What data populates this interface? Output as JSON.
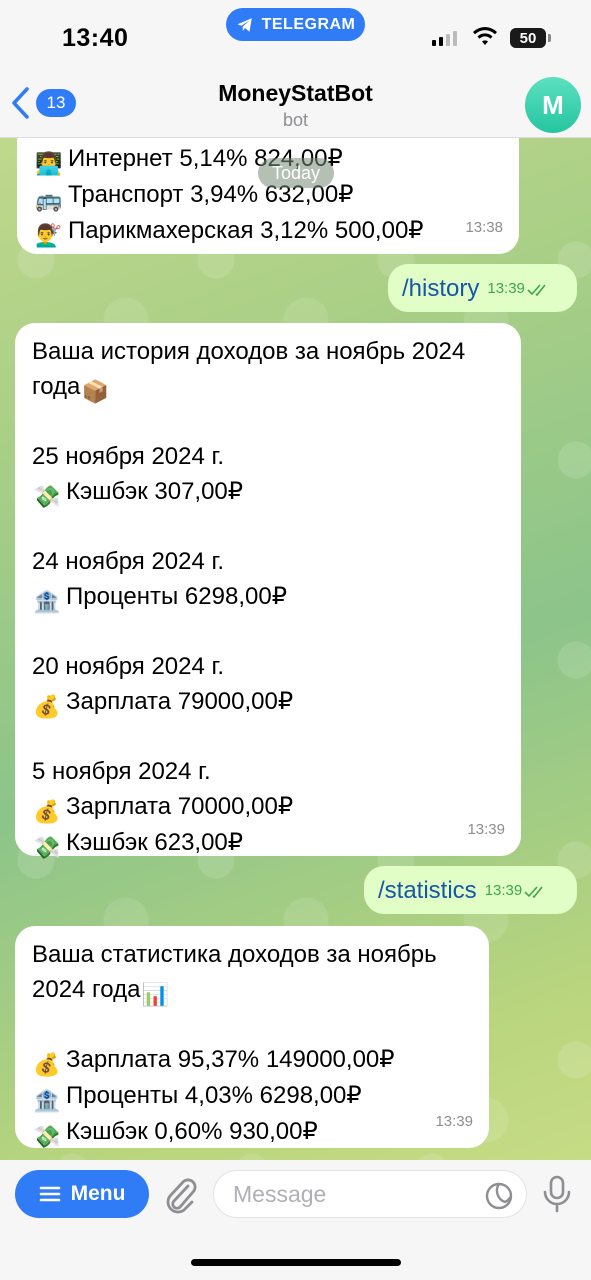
{
  "status_bar": {
    "time": "13:40",
    "app_pill": "TELEGRAM",
    "battery": "50"
  },
  "header": {
    "back_count": "13",
    "title": "MoneyStatBot",
    "subtitle": "bot",
    "avatar_letter": "M"
  },
  "date_chip": "Today",
  "messages": {
    "top_partial": {
      "lines": [
        {
          "emoji": "computer-person-emoji",
          "text": "Интернет 5,14% 824,00₽"
        },
        {
          "emoji": "bus-emoji",
          "text": "Транспорт 3,94% 632,00₽"
        },
        {
          "emoji": "haircut-person-emoji",
          "text": "Парикмахерская 3,12% 500,00₽"
        }
      ],
      "time": "13:38"
    },
    "cmd_history": {
      "text": "/history",
      "time": "13:39"
    },
    "history": {
      "title_line1": "Ваша история доходов за ноябрь 2024",
      "title_line2": "года",
      "entries": [
        {
          "date": "25 ноября 2024 г.",
          "items": [
            {
              "emoji": "money-wings-emoji",
              "text": "Кэшбэк 307,00₽"
            }
          ]
        },
        {
          "date": "24 ноября 2024 г.",
          "items": [
            {
              "emoji": "bank-emoji",
              "text": "Проценты 6298,00₽"
            }
          ]
        },
        {
          "date": "20 ноября 2024 г.",
          "items": [
            {
              "emoji": "money-bag-emoji",
              "text": "Зарплата 79000,00₽"
            }
          ]
        },
        {
          "date": "5 ноября 2024 г.",
          "items": [
            {
              "emoji": "money-bag-emoji",
              "text": "Зарплата 70000,00₽"
            },
            {
              "emoji": "money-wings-emoji",
              "text": "Кэшбэк 623,00₽"
            }
          ]
        }
      ],
      "time": "13:39"
    },
    "cmd_statistics": {
      "text": "/statistics",
      "time": "13:39"
    },
    "statistics": {
      "title_line1": "Ваша статистика доходов за ноябрь",
      "title_line2": "2024 года",
      "items": [
        {
          "emoji": "money-bag-emoji",
          "text": "Зарплата 95,37% 149000,00₽"
        },
        {
          "emoji": "bank-emoji",
          "text": "Проценты 4,03% 6298,00₽"
        },
        {
          "emoji": "money-wings-emoji",
          "text": "Кэшбэк 0,60% 930,00₽"
        }
      ],
      "time": "13:39"
    }
  },
  "input_bar": {
    "menu_label": "Menu",
    "placeholder": "Message"
  },
  "colors": {
    "accent": "#2f7cf6",
    "outgoing_bubble": "#e1fec6",
    "incoming_bubble": "#ffffff",
    "read_check": "#3da74a"
  }
}
